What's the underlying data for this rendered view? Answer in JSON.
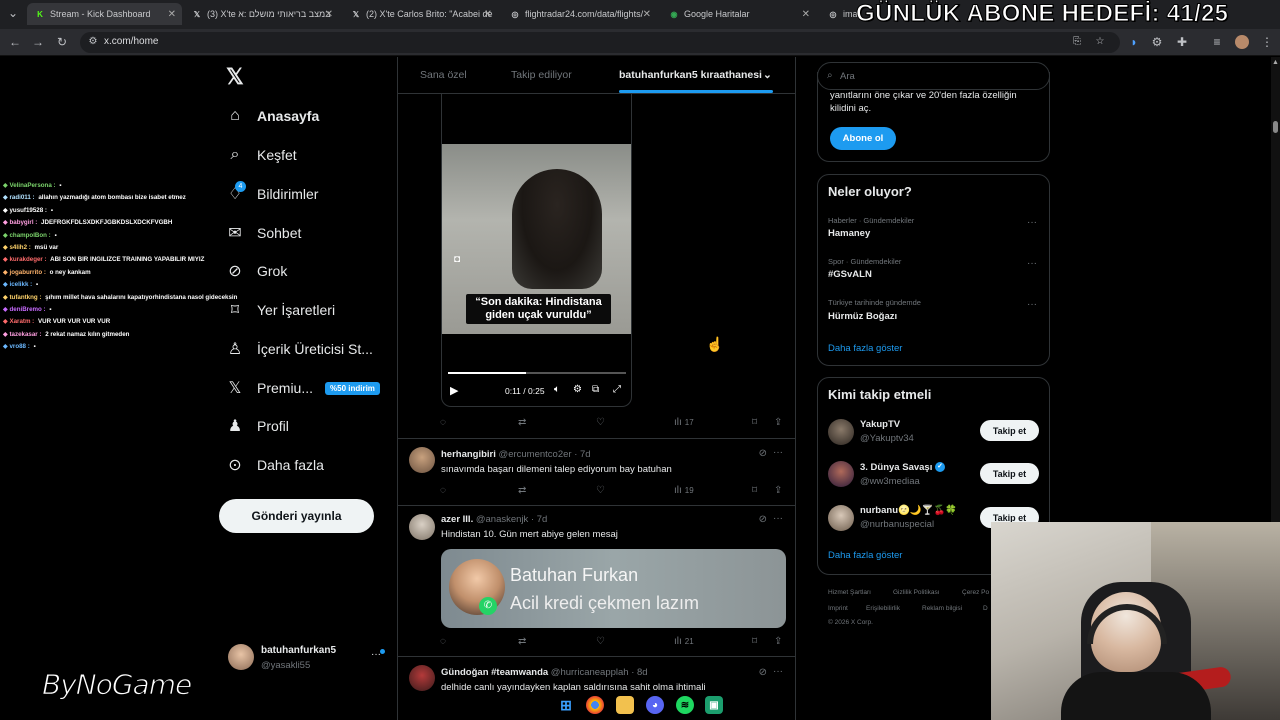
{
  "overlay_title": "GÜNLÜK ABONE HEDEFİ: 41/25",
  "browser": {
    "tabs": [
      {
        "label": "Stream - Kick Dashboard",
        "icon": "kick-icon",
        "color": "#53fc18"
      },
      {
        "label": "(3) X'te במצב בריאותי מושלם :א",
        "icon": "x-logo-icon",
        "color": "#ffffff"
      },
      {
        "label": "(2) X'te Carlos Brito: \"Acabei de",
        "icon": "x-logo-icon",
        "color": "#ffffff"
      },
      {
        "label": "flightradar24.com/data/flights/",
        "icon": "globe-icon",
        "color": "#cccccc"
      },
      {
        "label": "Google Haritalar",
        "icon": "maps-icon",
        "color": "#34a853"
      },
      {
        "label": "imag",
        "icon": "globe-icon",
        "color": "#cccccc"
      }
    ],
    "url": "x.com/home"
  },
  "chat": [
    {
      "user": "VelinaPersona",
      "msg": "",
      "color": "#7bd36b"
    },
    {
      "user": "radi011",
      "msg": "allahın yazmadığı atom bombası bize isabet etmez",
      "color": "#b2e2ff"
    },
    {
      "user": "yusuf19528",
      "msg": "",
      "color": "#ffffff"
    },
    {
      "user": "babygirl",
      "msg": "JDEFRGKFDLSXDKFJGBKDSLXDCKFVGBH",
      "color": "#ff9fe0"
    },
    {
      "user": "champolBon",
      "msg": "",
      "color": "#7bd36b"
    },
    {
      "user": "s4lih2",
      "msg": "msü var",
      "color": "#ffd36b"
    },
    {
      "user": "kurakdeger",
      "msg": "ABI SON BIR INGILIZCE TRAINING YAPABILIR MIYIZ",
      "color": "#ff6b6b"
    },
    {
      "user": "jogaburrito",
      "msg": "o ney kankam",
      "color": "#ffb36b"
    },
    {
      "user": "icelikk",
      "msg": "",
      "color": "#6bb8ff"
    },
    {
      "user": "tufantkng",
      "msg": "şıhım millet hava sahalarını kapatıyorhindistana nasol gideceksin",
      "color": "#ffd36b"
    },
    {
      "user": "deniBremo",
      "msg": "",
      "color": "#c86bff"
    },
    {
      "user": "Xaratm",
      "msg": "VUR VUR VUR VUR VUR",
      "color": "#ff6b6b"
    },
    {
      "user": "tazekasar",
      "msg": "2 rekat namaz kılın gitmeden",
      "color": "#ff9fe0"
    },
    {
      "user": "vro88",
      "msg": "",
      "color": "#6bb8ff"
    }
  ],
  "nav": {
    "items": [
      {
        "label": "Anasayfa",
        "icon": "home-icon"
      },
      {
        "label": "Keşfet",
        "icon": "search-icon"
      },
      {
        "label": "Bildirimler",
        "icon": "bell-icon",
        "badge": "4"
      },
      {
        "label": "Sohbet",
        "icon": "mail-icon"
      },
      {
        "label": "Grok",
        "icon": "grok-icon"
      },
      {
        "label": "Yer İşaretleri",
        "icon": "bookmark-icon"
      },
      {
        "label": "İçerik Üreticisi St...",
        "icon": "creator-icon"
      },
      {
        "label": "Premiu...",
        "icon": "x-logo-icon",
        "pill": "%50 indirim"
      },
      {
        "label": "Profil",
        "icon": "person-icon"
      },
      {
        "label": "Daha fazla",
        "icon": "more-circle-icon"
      }
    ],
    "post_button": "Gönderi yayınla",
    "account": {
      "name": "batuhanfurkan5",
      "handle": "@yasakli55"
    }
  },
  "feed": {
    "tabs": [
      "Sana özel",
      "Takip ediliyor",
      "batuhanfurkan5 kıraathanesi"
    ],
    "video": {
      "caption": "“Son dakika: Hindistana giden uçak vuruldu”",
      "time": "0:11 / 0:25",
      "progress": 0.44
    },
    "first_actions": {
      "views": "17"
    },
    "tweets": [
      {
        "name": "herhangibiri",
        "handle": "@ercumentco2er",
        "age": "· 7d",
        "text": "sınavımda başarı dilemeni talep ediyorum bay batuhan",
        "views": "19"
      },
      {
        "name": "azer III.",
        "handle": "@anaskenjk",
        "age": "· 7d",
        "text": "Hindistan 10. Gün mert abiye gelen mesaj",
        "views": "21",
        "image": {
          "title": "Batuhan Furkan",
          "subtitle": "Acil kredi çekmen lazım"
        }
      },
      {
        "name": "Gündoğan #teamwanda",
        "handle": "@hurricaneapplah",
        "age": "· 8d",
        "text": "delhide canlı yayındayken kaplan saldırısına sahit olma ihtimali"
      }
    ]
  },
  "right": {
    "search_placeholder": "Ara",
    "premium_text_1": "yanıtlarını öne çıkar ve 20'den fazla özelliğin",
    "premium_text_2": "kilidini aç.",
    "premium_button": "Abone ol",
    "trends_title": "Neler oluyor?",
    "trends": [
      {
        "meta": "Haberler · Gündemdekiler",
        "name": "Hamaney"
      },
      {
        "meta": "Spor · Gündemdekiler",
        "name": "#GSvALN"
      },
      {
        "meta": "Türkiye tarihinde gündemde",
        "name": "Hürmüz Boğazı"
      }
    ],
    "show_more": "Daha fazla göster",
    "who_title": "Kimi takip etmeli",
    "who": [
      {
        "name": "YakupTV",
        "handle": "@Yakuptv34",
        "button": "Takip et"
      },
      {
        "name": "3. Dünya Savaşı",
        "handle": "@ww3mediaa",
        "button": "Takip et",
        "verified": true
      },
      {
        "name": "nurbanu🌝🌙🍸🍒🍀",
        "handle": "@nurbanuspecial",
        "button": "Takip et"
      }
    ],
    "footer": [
      "Hizmet Şartları",
      "Gizlilik Politikası",
      "Çerez Po",
      "Imprint",
      "Erişilebilirlik",
      "Reklam bilgisi",
      "D",
      "© 2026 X Corp."
    ]
  },
  "watermark": "ByNoGame"
}
